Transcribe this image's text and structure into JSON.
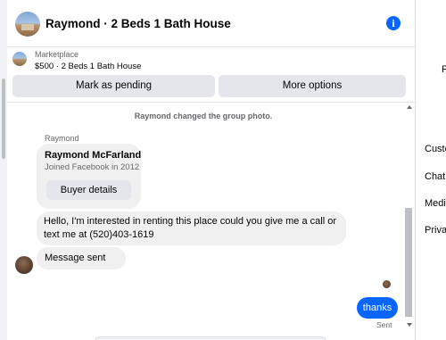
{
  "header": {
    "title": "Raymond · 2 Beds 1 Bath House",
    "info_icon": "i"
  },
  "marketplace": {
    "label": "Marketplace",
    "listing": "$500 · 2 Beds 1 Bath House",
    "pending_button": "Mark as pending",
    "more_button": "More options"
  },
  "conversation": {
    "system_message": "Raymond changed the group photo.",
    "sender_name": "Raymond",
    "profile_card": {
      "name": "Raymond McFarland",
      "joined": "Joined Facebook in 2012",
      "button": "Buyer details"
    },
    "messages": [
      {
        "from": "Raymond",
        "text": "Hello, I'm interested in renting this place could you give me a call or text me at (520)403-1619"
      },
      {
        "from": "Raymond",
        "text": "Message sent"
      },
      {
        "from": "me",
        "text": "thanks"
      }
    ],
    "status": "Sent"
  },
  "right_sidebar": {
    "items": [
      "F",
      "Custo",
      "Chat",
      "Medi",
      "Priva"
    ]
  },
  "colors": {
    "accent": "#0866ff",
    "bubble_in": "#f0f0f0",
    "muted_text": "#65676b"
  }
}
